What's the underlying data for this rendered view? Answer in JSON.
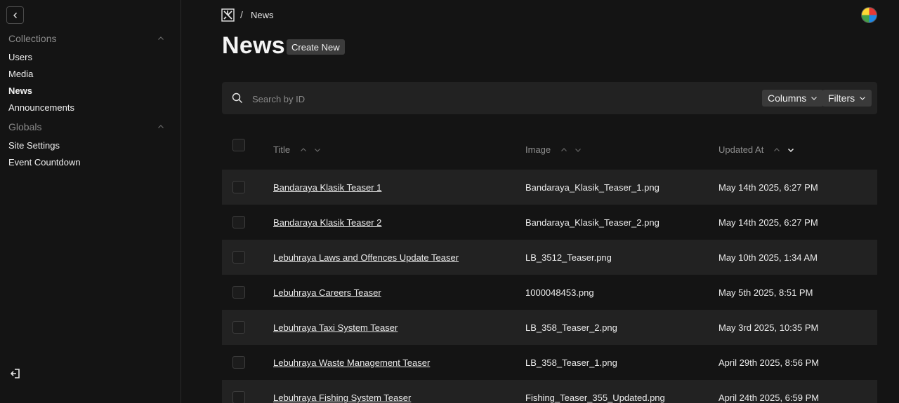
{
  "sidebar": {
    "groups": [
      {
        "label": "Collections",
        "items": [
          {
            "label": "Users"
          },
          {
            "label": "Media"
          },
          {
            "label": "News"
          },
          {
            "label": "Announcements"
          }
        ]
      },
      {
        "label": "Globals",
        "items": [
          {
            "label": "Site Settings"
          },
          {
            "label": "Event Countdown"
          }
        ]
      }
    ]
  },
  "breadcrumb": {
    "separator": "/",
    "current": "News"
  },
  "page": {
    "title": "News",
    "create_label": "Create New"
  },
  "search": {
    "placeholder": "Search by ID",
    "columns_label": "Columns",
    "filters_label": "Filters"
  },
  "table": {
    "columns": [
      {
        "label": "Title"
      },
      {
        "label": "Image"
      },
      {
        "label": "Updated At",
        "sorted": "desc"
      }
    ],
    "rows": [
      {
        "title": "Bandaraya Klasik Teaser 1",
        "image": "Bandaraya_Klasik_Teaser_1.png",
        "updated": "May 14th 2025, 6:27 PM"
      },
      {
        "title": "Bandaraya Klasik Teaser 2",
        "image": "Bandaraya_Klasik_Teaser_2.png",
        "updated": "May 14th 2025, 6:27 PM"
      },
      {
        "title": "Lebuhraya Laws and Offences Update Teaser",
        "image": "LB_3512_Teaser.png",
        "updated": "May 10th 2025, 1:34 AM"
      },
      {
        "title": "Lebuhraya Careers Teaser",
        "image": "1000048453.png",
        "updated": "May 5th 2025, 8:51 PM"
      },
      {
        "title": "Lebuhraya Taxi System Teaser",
        "image": "LB_358_Teaser_2.png",
        "updated": "May 3rd 2025, 10:35 PM"
      },
      {
        "title": "Lebuhraya Waste Management Teaser",
        "image": "LB_358_Teaser_1.png",
        "updated": "April 29th 2025, 8:56 PM"
      },
      {
        "title": "Lebuhraya Fishing System Teaser",
        "image": "Fishing_Teaser_355_Updated.png",
        "updated": "April 24th 2025, 6:59 PM"
      }
    ]
  },
  "icons": {
    "collapse": "chevron-left-icon",
    "group_toggle": "chevron-up-icon",
    "logout": "logout-icon",
    "logo": "payload-logo-icon",
    "search": "search-icon",
    "dropdown": "chevron-down-icon"
  },
  "colors": {
    "background": "#141414",
    "surface": "#222222",
    "button": "#3a3a3a",
    "muted_text": "#8a8a8a"
  }
}
